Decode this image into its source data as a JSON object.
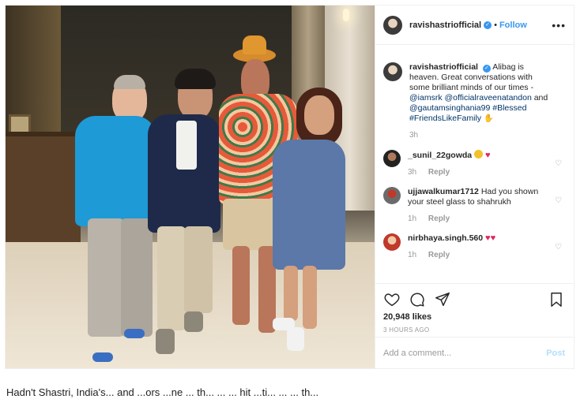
{
  "header": {
    "username": "ravishastriofficial",
    "verified_mark": "✓",
    "separator": "•",
    "follow_label": "Follow",
    "more_label": "•••"
  },
  "comments": [
    {
      "username": "ravishastriofficial",
      "verified": true,
      "text_prefix": "Alibag is heaven. Great conversations with some brilliant minds of our times - ",
      "mentions": [
        "@iamsrk",
        "@officialraveenatandon",
        "and",
        "@gautamsinghania99",
        "#Blessed",
        "#FriendsLikeFamily"
      ],
      "time": "3h",
      "reply_label": ""
    },
    {
      "username": "_sunil_22gowda",
      "text": "",
      "time": "3h",
      "reply_label": "Reply"
    },
    {
      "username": "ujjawalkumar1712",
      "text": "Had you shown your steel glass to shahrukh",
      "time": "1h",
      "reply_label": "Reply"
    },
    {
      "username": "nirbhaya.singh.560",
      "text": "",
      "time": "1h",
      "reply_label": "Reply"
    }
  ],
  "actions": {
    "likes": "20,948 likes",
    "timestamp": "3 HOURS AGO"
  },
  "comment_box": {
    "placeholder": "Add a comment...",
    "post_label": "Post"
  },
  "article": {
    "caption_fragment": "Hadn't Shastri, India's... and ...ors ...ne ... th... ... ... hit ...ti... ... ... th..."
  },
  "colors": {
    "link_blue": "#3897f0",
    "mention_blue": "#003569",
    "heart_red": "#e0245e",
    "muted_grey": "#999999"
  }
}
